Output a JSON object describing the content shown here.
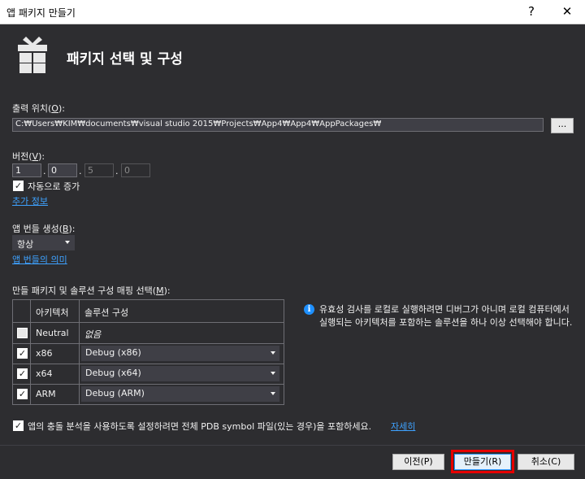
{
  "window": {
    "title": "앱 패키지 만들기",
    "help": "?",
    "close": "✕"
  },
  "header": {
    "title": "패키지 선택 및 구성"
  },
  "output": {
    "label": "출력 위치(",
    "mnemonic": "O",
    "label_end": "):",
    "path": "C:₩Users₩KIM₩documents₩visual studio 2015₩Projects₩App4₩App4₩AppPackages₩",
    "browse": "..."
  },
  "version": {
    "label": "버전(",
    "mnemonic": "V",
    "label_end": "):",
    "major": "1",
    "minor": "0",
    "build": "5",
    "revision": "0",
    "auto_increment": "자동으로 증가",
    "more_info": "추가 정보"
  },
  "bundle": {
    "label": "앱 번들 생성(",
    "mnemonic": "B",
    "label_end": "):",
    "selected": "항상",
    "meaning_link": "앱 번들의 의미"
  },
  "packages": {
    "label": "만들 패키지 및 솔루션 구성 매핑 선택(",
    "mnemonic": "M",
    "label_end": "):",
    "col_arch": "아키텍처",
    "col_config": "솔루션 구성",
    "rows": [
      {
        "checked": false,
        "arch": "Neutral",
        "config": "없음"
      },
      {
        "checked": true,
        "arch": "x86",
        "config": "Debug (x86)"
      },
      {
        "checked": true,
        "arch": "x64",
        "config": "Debug (x64)"
      },
      {
        "checked": true,
        "arch": "ARM",
        "config": "Debug (ARM)"
      }
    ]
  },
  "info": {
    "text": "유효성 검사를 로컬로 실행하려면 디버그가 아니며 로컬 컴퓨터에서 실행되는 아키텍처를 포함하는 솔루션을 하나 이상 선택해야 합니다."
  },
  "crash": {
    "text": "앱의 충돌 분석을 사용하도록 설정하려면 전체 PDB symbol 파일(있는 경우)을 포함하세요.",
    "link": "자세히"
  },
  "buttons": {
    "prev": "이전(P)",
    "create": "만들기(R)",
    "cancel": "취소(C)"
  },
  "colors": {
    "background": "#2d2d30",
    "link": "#3ea2ff",
    "highlight": "#e60000",
    "info": "#1e90ff"
  }
}
